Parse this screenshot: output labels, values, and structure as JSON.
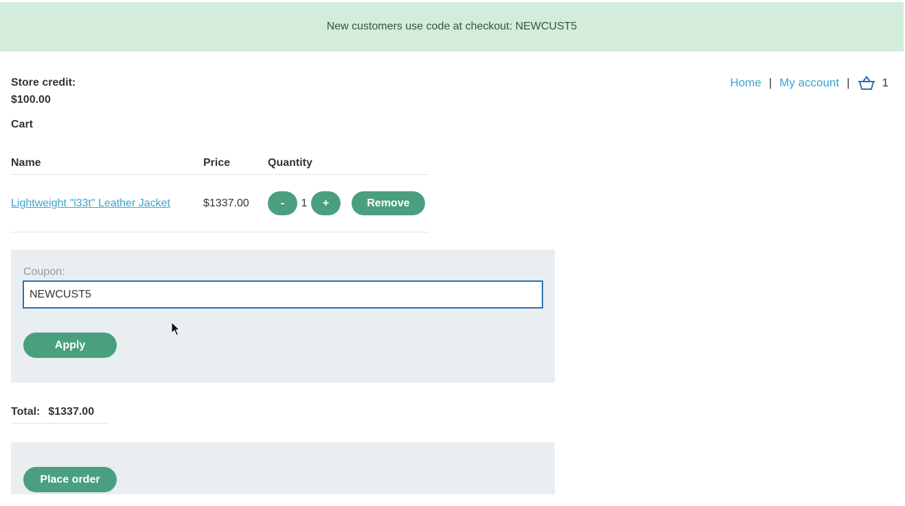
{
  "banner": {
    "text": "New customers use code at checkout: NEWCUST5"
  },
  "nav": {
    "home": "Home",
    "separator": "|",
    "my_account": "My account",
    "cart_count": "1"
  },
  "store_credit": {
    "label": "Store credit:",
    "value": "$100.00"
  },
  "cart": {
    "title": "Cart",
    "columns": [
      "Name",
      "Price",
      "Quantity"
    ],
    "items": [
      {
        "name": "Lightweight \"l33t\" Leather Jacket",
        "price": "$1337.00",
        "decrement_label": "-",
        "quantity": "1",
        "increment_label": "+",
        "remove_label": "Remove"
      }
    ]
  },
  "coupon": {
    "label": "Coupon:",
    "value": "NEWCUST5",
    "apply_label": "Apply"
  },
  "total": {
    "label": "Total:",
    "value": "$1337.00"
  },
  "order": {
    "place_order_label": "Place order"
  },
  "colors": {
    "banner_bg": "#d4ecdb",
    "link": "#3aa3cf",
    "button": "#4a9f7f",
    "panel_bg": "#e9eef1",
    "input_border": "#2c6db0"
  }
}
